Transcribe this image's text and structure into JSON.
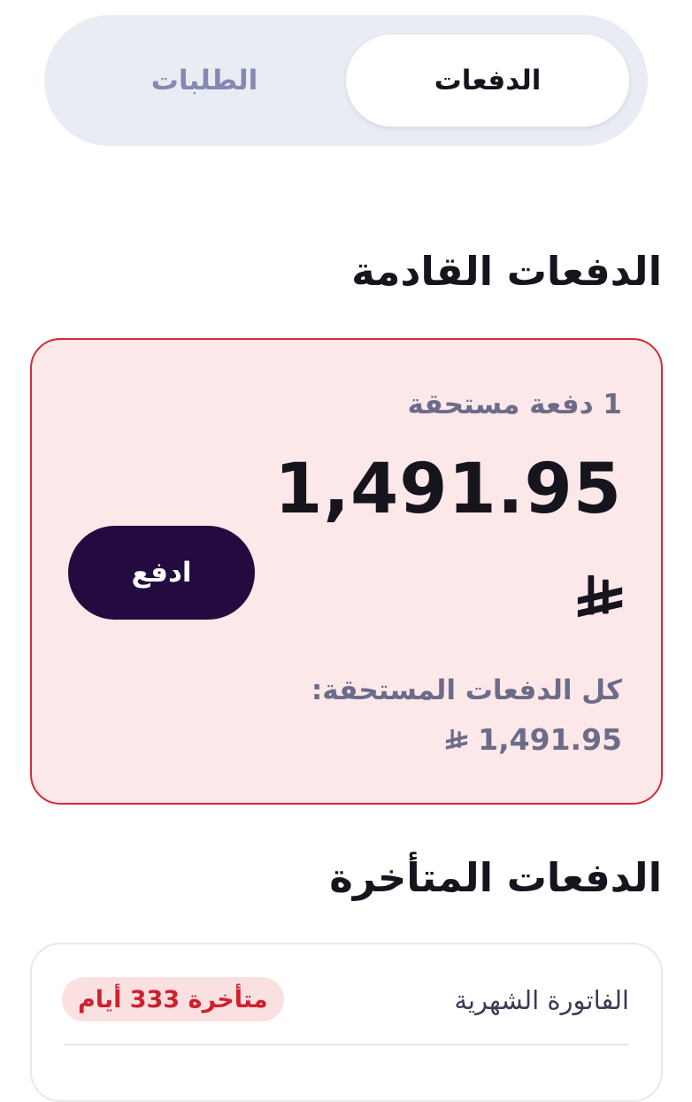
{
  "tabs": {
    "payments_label": "الدفعات",
    "orders_label": "الطلبات",
    "active": "payments"
  },
  "upcoming": {
    "title": "الدفعات القادمة",
    "due_count_label": "1 دفعة مستحقة",
    "amount": "1,491.95",
    "currency_icon": "saudi-riyal-icon",
    "pay_button_label": "ادفع",
    "total_label": "كل الدفعات المستحقة:",
    "total_amount": "1,491.95"
  },
  "overdue": {
    "title": "الدفعات المتأخرة",
    "items": [
      {
        "label": "الفاتورة الشهرية",
        "status_badge": "متأخرة 333 أيام"
      }
    ]
  },
  "colors": {
    "due_card_background": "#fce8e9",
    "due_card_border": "#d42a37",
    "pay_button": "#240b3f",
    "late_badge_text": "#cf2030",
    "late_badge_background": "#fbe0e2",
    "tab_track": "#e9ecf3",
    "inactive_tab_text": "#8588b0"
  }
}
